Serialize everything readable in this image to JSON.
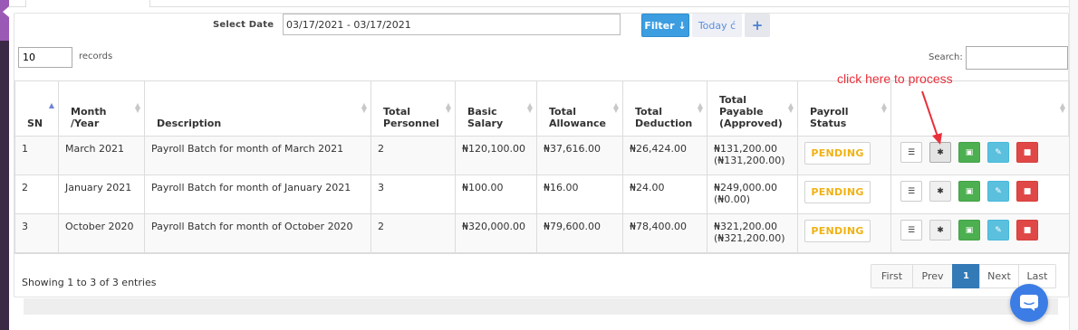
{
  "filters": {
    "select_date_label": "Select Date",
    "date_range_value": "03/17/2021 - 03/17/2021",
    "filter_button": "Filter ↓",
    "today_button": "Today ć",
    "add_button": "+"
  },
  "table_controls": {
    "records_count": "10",
    "records_label": "records",
    "search_label": "Search:",
    "search_value": ""
  },
  "annotation": "click here to process",
  "table": {
    "columns": [
      {
        "label": "SN",
        "sorted": "asc"
      },
      {
        "label": "Month /Year"
      },
      {
        "label": "Description"
      },
      {
        "label": "Total Personnel"
      },
      {
        "label": "Basic Salary"
      },
      {
        "label": "Total Allowance"
      },
      {
        "label": "Total Deduction"
      },
      {
        "label": "Total Payable (Approved)"
      },
      {
        "label": "Payroll Status"
      },
      {
        "label": ""
      }
    ],
    "rows": [
      {
        "sn": "1",
        "month_year": "March 2021",
        "description": "Payroll Batch for month of March 2021",
        "personnel": "2",
        "basic": "₦120,100.00",
        "allowance": "₦37,616.00",
        "deduction": "₦26,424.00",
        "payable": "₦131,200.00",
        "approved": "(₦131,200.00)",
        "status": "PENDING"
      },
      {
        "sn": "2",
        "month_year": "January 2021",
        "description": "Payroll Batch for month of January 2021",
        "personnel": "3",
        "basic": "₦100.00",
        "allowance": "₦16.00",
        "deduction": "₦24.00",
        "payable": "₦249,000.00",
        "approved": "(₦0.00)",
        "status": "PENDING"
      },
      {
        "sn": "3",
        "month_year": "October 2020",
        "description": "Payroll Batch for month of October 2020",
        "personnel": "2",
        "basic": "₦320,000.00",
        "allowance": "₦79,600.00",
        "deduction": "₦78,400.00",
        "payable": "₦321,200.00",
        "approved": "(₦321,200.00)",
        "status": "PENDING"
      }
    ],
    "row_actions": [
      "list-icon",
      "gear-icon",
      "excel-icon",
      "edit-icon",
      "delete-icon"
    ]
  },
  "footer": {
    "info": "Showing 1 to 3 of 3 entries",
    "pagination": {
      "first": "First",
      "prev": "Prev",
      "current": "1",
      "next": "Next",
      "last": "Last"
    }
  },
  "colors": {
    "primary": "#3c9de1",
    "pending": "#f0b214",
    "annotation": "#e8303a",
    "page_active": "#337ab7",
    "excel": "#4caf50",
    "edit": "#5bc0de",
    "delete": "#e04848"
  }
}
